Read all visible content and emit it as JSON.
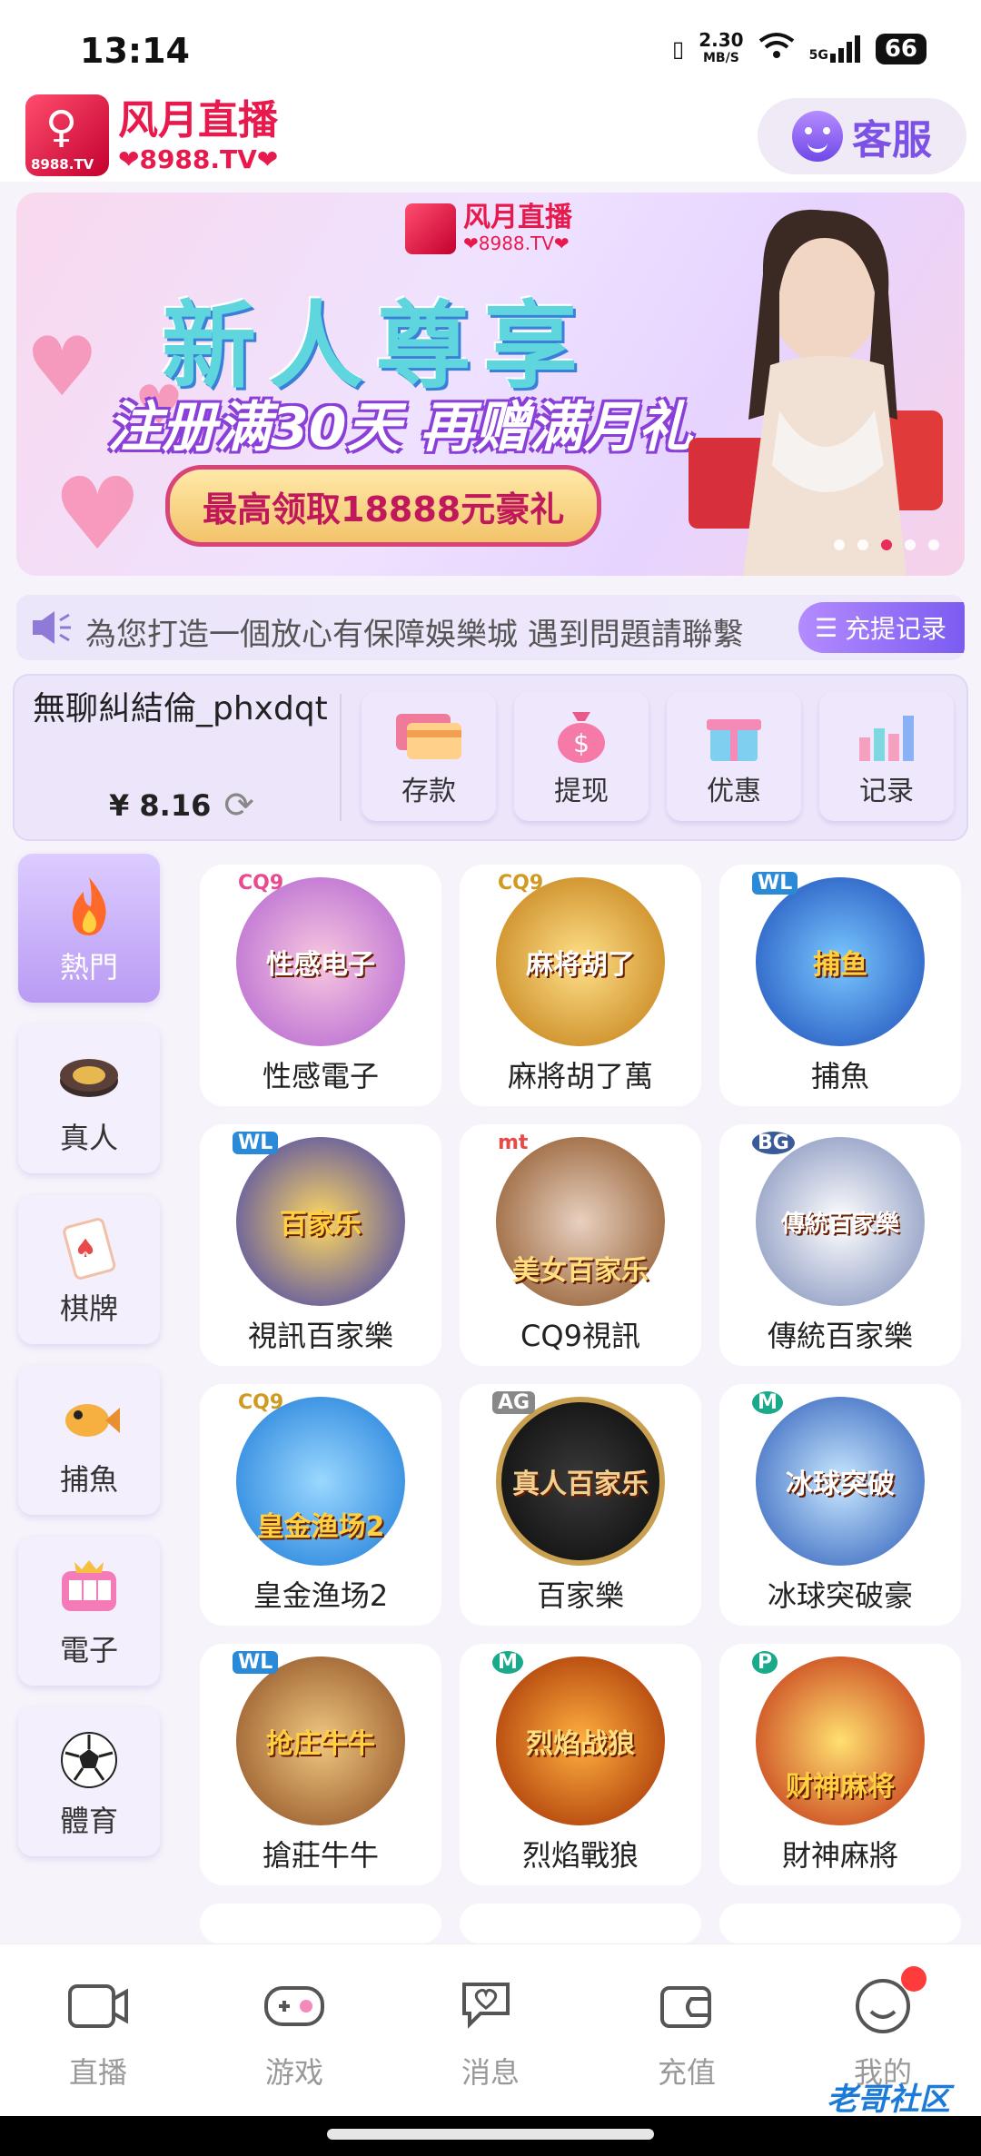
{
  "status_bar": {
    "time": "13:14",
    "speed": "2.30",
    "speed_unit": "MB/S",
    "network": "5G",
    "battery": "66"
  },
  "header": {
    "logo_name": "风月直播",
    "logo_domain": "❤8988.TV❤",
    "logo_tv": "8988.TV",
    "service_label": "客服"
  },
  "banner": {
    "brand_name": "风月直播",
    "brand_domain": "❤8988.TV❤",
    "title": "新人尊享",
    "subtitle": "注册满30天 再赠满月礼",
    "pill": "最高领取18888元豪礼",
    "dots": 5,
    "active_dot": 3
  },
  "notice": {
    "text": "為您打造一個放心有保障娛樂城  遇到問題請聯繫",
    "record_button": "充提记录"
  },
  "account": {
    "username": "無聊糾結倫_phxdqt",
    "balance": "¥ 8.16",
    "actions": [
      {
        "label": "存款",
        "icon": "card-icon"
      },
      {
        "label": "提现",
        "icon": "money-bag-icon"
      },
      {
        "label": "优惠",
        "icon": "gift-icon"
      },
      {
        "label": "记录",
        "icon": "bar-chart-icon"
      }
    ]
  },
  "categories": [
    {
      "label": "熱門",
      "icon": "flame-icon",
      "active": true
    },
    {
      "label": "真人",
      "icon": "chip-icon",
      "active": false
    },
    {
      "label": "棋牌",
      "icon": "playing-card-icon",
      "active": false
    },
    {
      "label": "捕魚",
      "icon": "fish-icon",
      "active": false
    },
    {
      "label": "電子",
      "icon": "slot-machine-icon",
      "active": false
    },
    {
      "label": "體育",
      "icon": "soccer-ball-icon",
      "active": false
    }
  ],
  "games": [
    {
      "label": "性感電子",
      "tag": "CQ9",
      "art": "性感电子"
    },
    {
      "label": "麻將胡了萬",
      "tag": "CQ9",
      "art": "麻将胡了"
    },
    {
      "label": "捕魚",
      "tag": "WL",
      "art": "捕鱼"
    },
    {
      "label": "視訊百家樂",
      "tag": "WL",
      "art": "百家乐"
    },
    {
      "label": "CQ9視訊",
      "tag": "mt",
      "art": "美女百家乐"
    },
    {
      "label": "傳統百家樂",
      "tag": "BG",
      "art": "傳統百家樂"
    },
    {
      "label": "皇金渔场2",
      "tag": "CQ9",
      "art": "皇金渔场2"
    },
    {
      "label": "百家樂",
      "tag": "AG",
      "art": "真人百家乐"
    },
    {
      "label": "冰球突破豪",
      "tag": "M",
      "art": "冰球突破"
    },
    {
      "label": "搶莊牛牛",
      "tag": "WL",
      "art": "抢庄牛牛"
    },
    {
      "label": "烈焰戰狼",
      "tag": "M",
      "art": "烈焰战狼"
    },
    {
      "label": "財神麻將",
      "tag": "P",
      "art": "财神麻将"
    }
  ],
  "bottom_nav": [
    {
      "label": "直播",
      "icon": "camera-icon"
    },
    {
      "label": "游戏",
      "icon": "gamepad-icon"
    },
    {
      "label": "消息",
      "icon": "chat-heart-icon"
    },
    {
      "label": "充值",
      "icon": "wallet-icon"
    },
    {
      "label": "我的",
      "icon": "smile-icon",
      "badge": true
    }
  ],
  "watermark": "老哥社区",
  "colors": {
    "accent": "#7b5cf0",
    "brand": "#e8194c",
    "active_category": "#b99bf4"
  }
}
